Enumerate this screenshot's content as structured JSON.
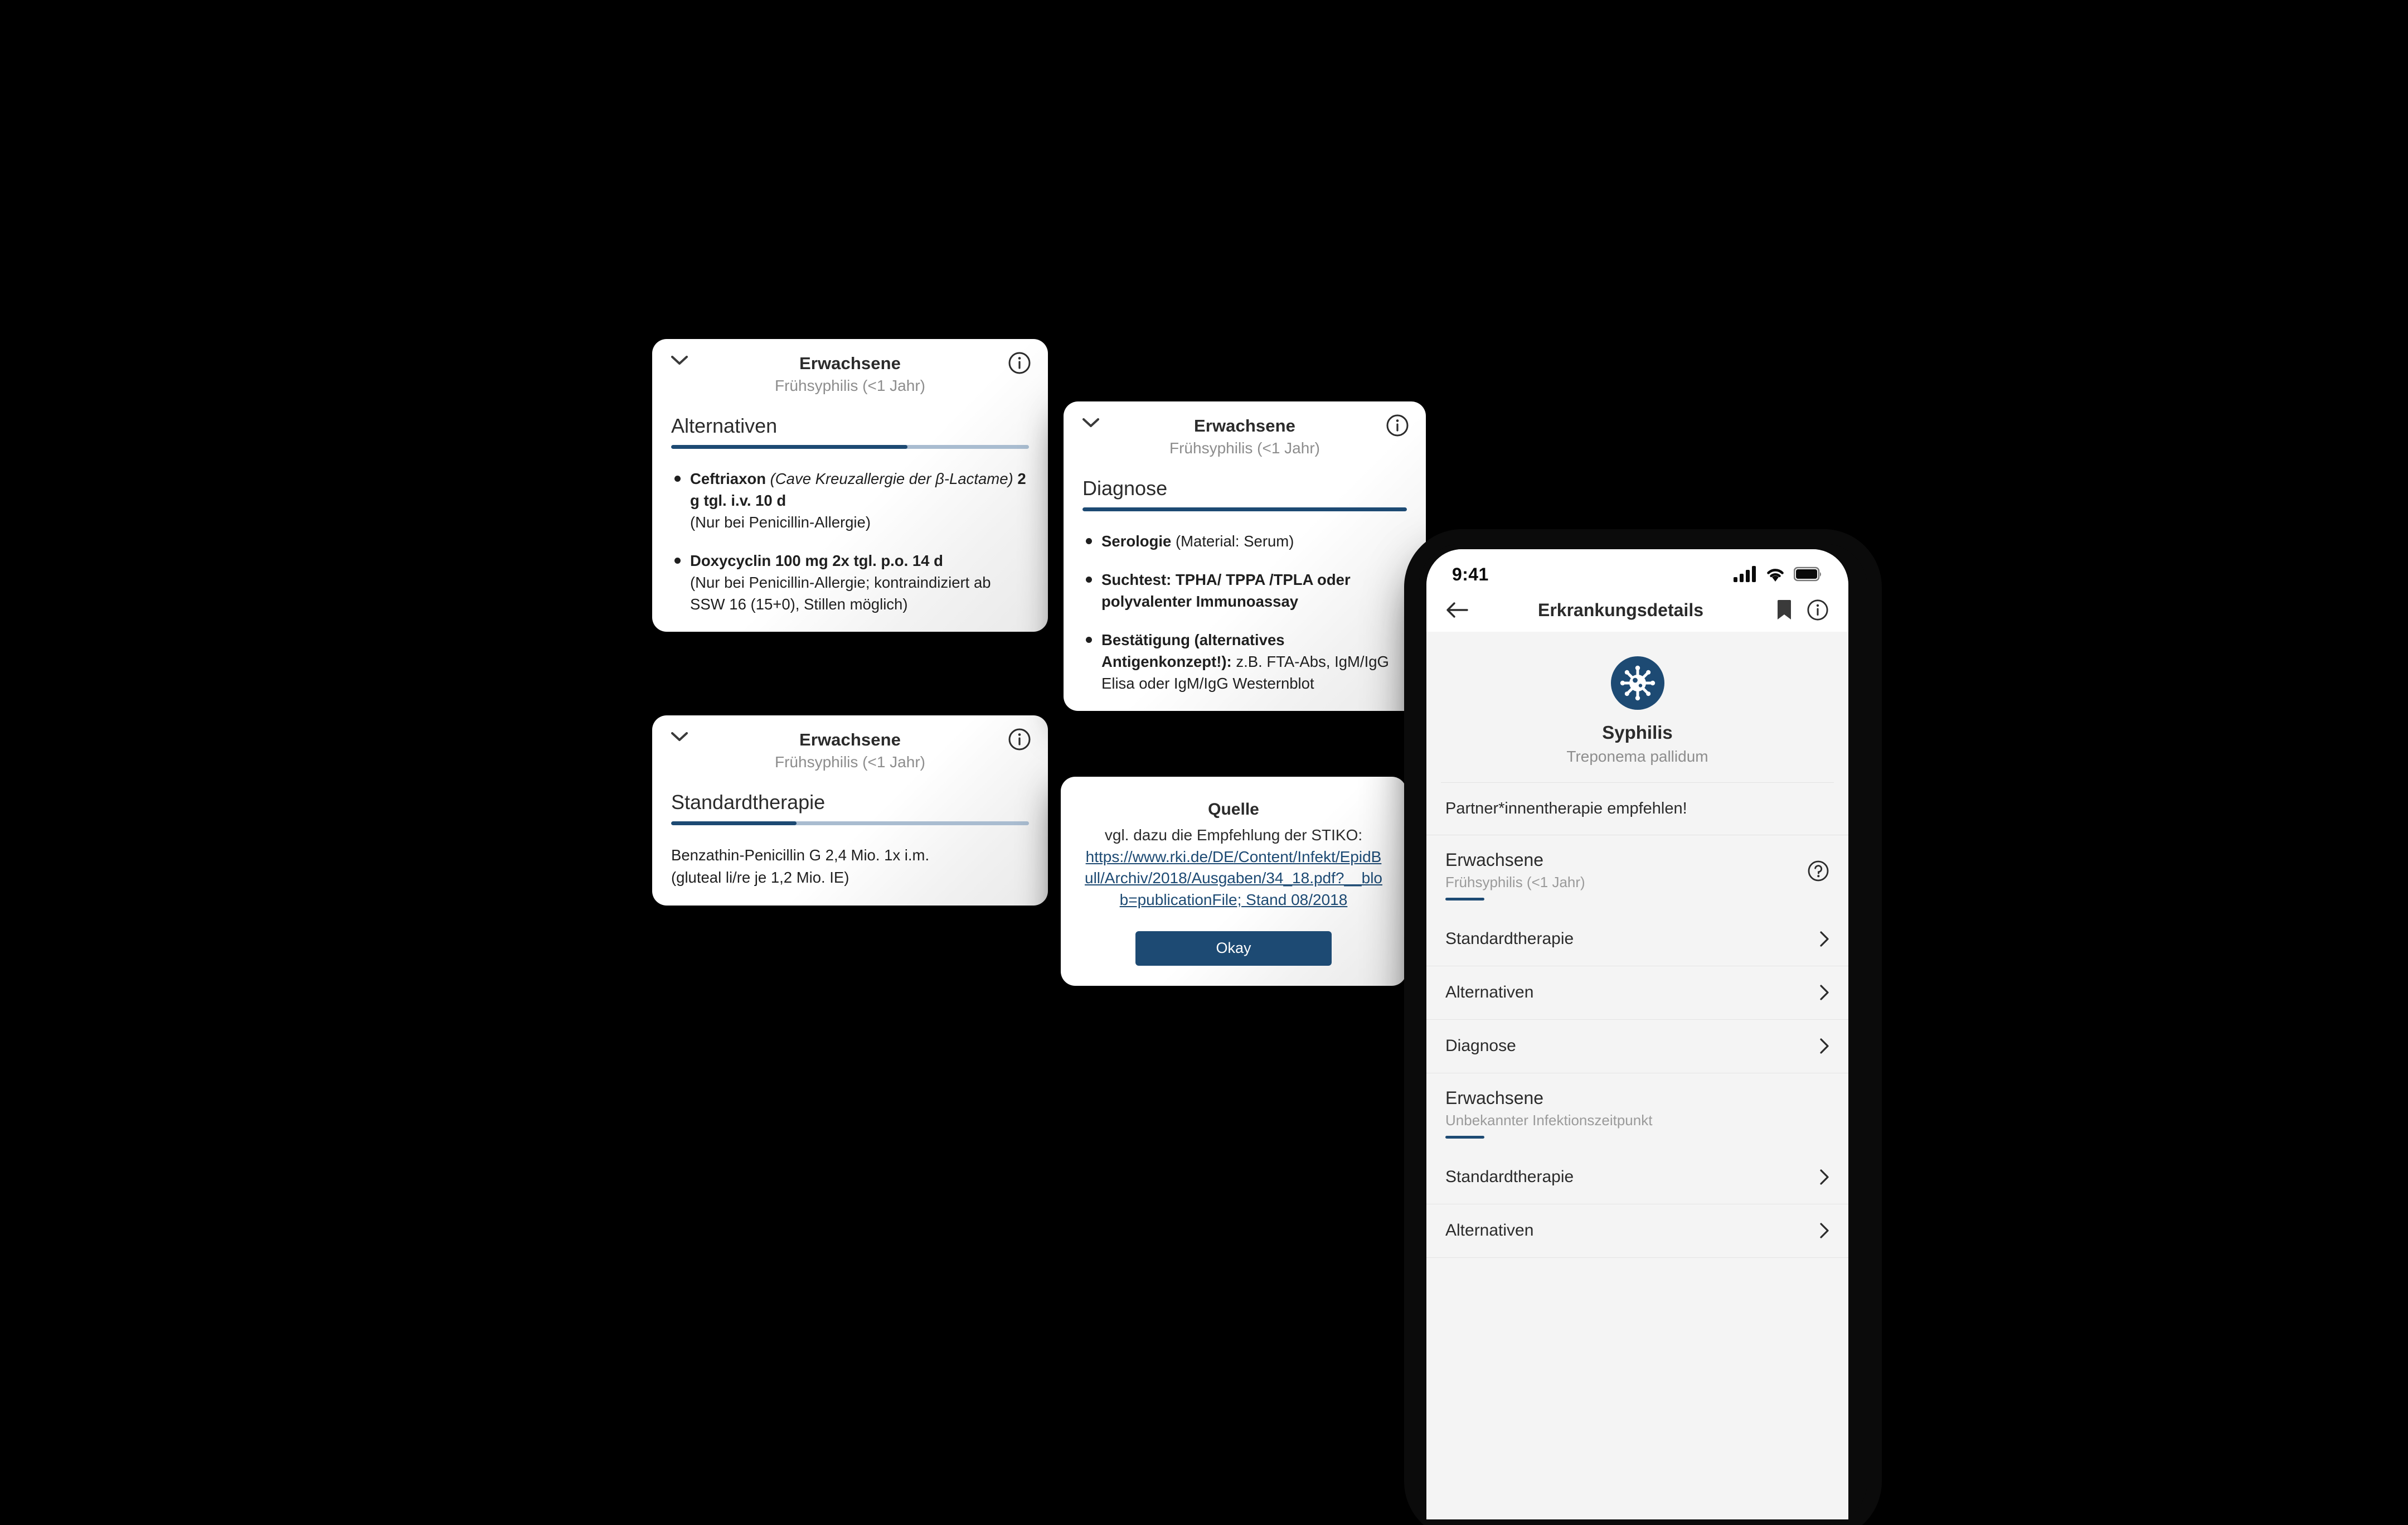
{
  "theme": {
    "background": "#000000",
    "accent": "#1d4a73",
    "accent_light": "#a9bcd0",
    "card_bg": "#ffffff",
    "phone_bg": "#f4f4f4",
    "text": "#2b2b2b",
    "muted": "#8d8d8d"
  },
  "cards": {
    "alternativen": {
      "title": "Erwachsene",
      "subtitle": "Frühsyphilis (<1 Jahr)",
      "section": "Alternativen",
      "progress_percent": 66,
      "chevron_icon": "chevron-down-icon",
      "info_icon": "info-icon",
      "items": [
        {
          "lead": "Ceftriaxon",
          "italic": "(Cave Kreuzallergie der β-Lactame)",
          "dose": "2 g tgl. i.v. 10 d",
          "note": "(Nur bei Penicillin-Allergie)"
        },
        {
          "lead": "Doxycyclin 100 mg 2x tgl. p.o. 14 d",
          "italic": "",
          "dose": "",
          "note": "(Nur bei Penicillin-Allergie; kontraindiziert ab SSW 16 (15+0), Stillen möglich)"
        }
      ]
    },
    "standardtherapie": {
      "title": "Erwachsene",
      "subtitle": "Frühsyphilis (<1 Jahr)",
      "section": "Standardtherapie",
      "progress_percent": 35,
      "chevron_icon": "chevron-down-icon",
      "info_icon": "info-icon",
      "body_line1": "Benzathin-Penicillin G 2,4 Mio. 1x i.m.",
      "body_line2": "(gluteal li/re je 1,2 Mio. IE)"
    },
    "diagnose": {
      "title": "Erwachsene",
      "subtitle": "Frühsyphilis (<1 Jahr)",
      "section": "Diagnose",
      "progress_percent": 100,
      "chevron_icon": "chevron-down-icon",
      "info_icon": "info-icon",
      "items": [
        {
          "bold": "Serologie",
          "rest": " (Material: Serum)"
        },
        {
          "bold": "Suchtest: TPHA/ TPPA /TPLA oder polyvalenter Immunoassay",
          "rest": ""
        },
        {
          "bold": "Bestätigung (alternatives Antigenkonzept!):",
          "rest": " z.B. FTA-Abs, IgM/IgG Elisa oder IgM/IgG Westernblot"
        }
      ]
    }
  },
  "dialog": {
    "title": "Quelle",
    "intro": "vgl. dazu die Empfehlung der STIKO:",
    "link": "https://www.rki.de/DE/Content/Infekt/EpidBull/Archiv/2018/Ausgaben/34_18.pdf?__blob=publicationFile; Stand 08/2018",
    "button": "Okay"
  },
  "phone": {
    "statusbar": {
      "time": "9:41",
      "cellular_icon": "cellular-signal-icon",
      "wifi_icon": "wifi-icon",
      "battery_icon": "battery-full-icon"
    },
    "navbar": {
      "back_icon": "back-arrow-icon",
      "title": "Erkrankungsdetails",
      "bookmark_icon": "bookmark-icon",
      "info_icon": "info-icon"
    },
    "hero": {
      "icon": "virus-icon",
      "name": "Syphilis",
      "latin": "Treponema pallidum"
    },
    "notice": "Partner*innentherapie empfehlen!",
    "groups": [
      {
        "title": "Erwachsene",
        "subtitle": "Frühsyphilis (<1 Jahr)",
        "help_icon": "help-circle-icon",
        "rows": [
          {
            "label": "Standardtherapie",
            "chevron_icon": "chevron-right-icon"
          },
          {
            "label": "Alternativen",
            "chevron_icon": "chevron-right-icon"
          },
          {
            "label": "Diagnose",
            "chevron_icon": "chevron-right-icon"
          }
        ]
      },
      {
        "title": "Erwachsene",
        "subtitle": "Unbekannter Infektionszeitpunkt",
        "help_icon": "",
        "rows": [
          {
            "label": "Standardtherapie",
            "chevron_icon": "chevron-right-icon"
          },
          {
            "label": "Alternativen",
            "chevron_icon": "chevron-right-icon"
          }
        ]
      }
    ]
  }
}
